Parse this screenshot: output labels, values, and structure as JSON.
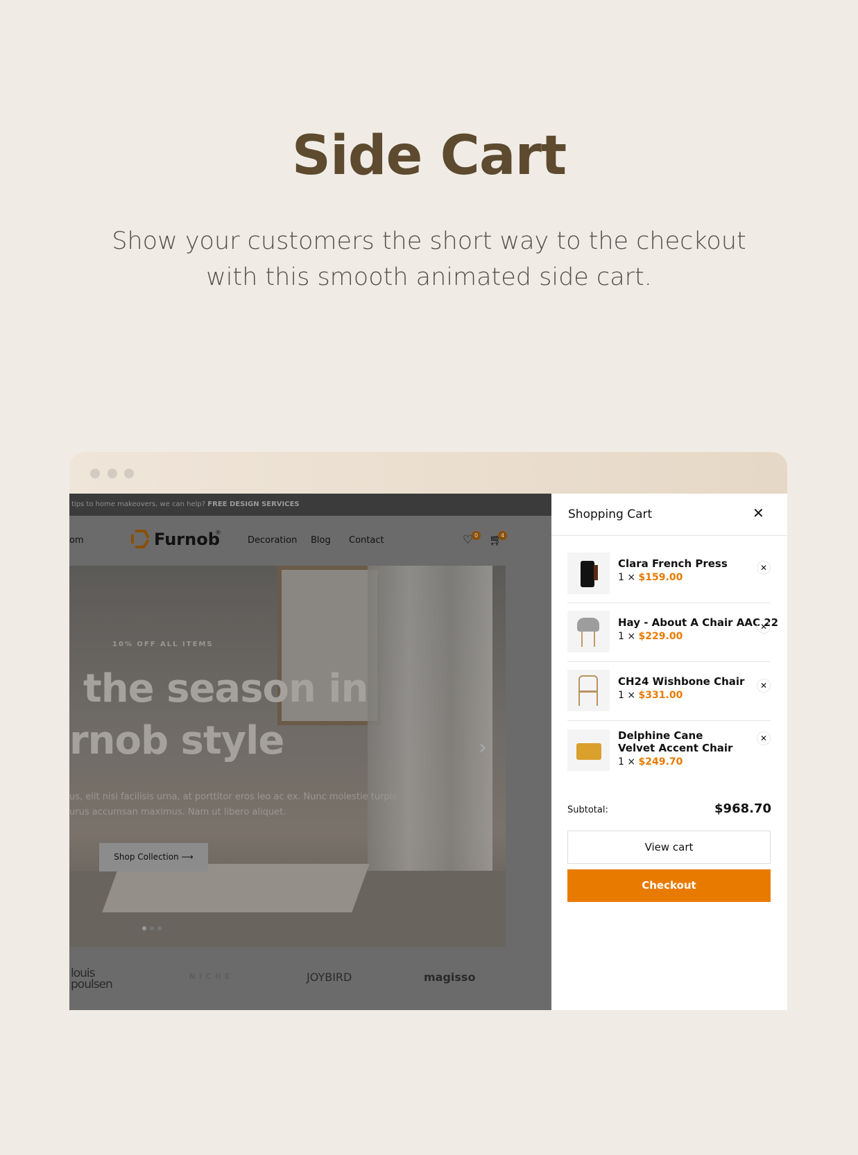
{
  "heading": {
    "title": "Side Cart",
    "subtitle_line1": "Show your customers the short way to the checkout",
    "subtitle_line2": "with this smooth animated side cart."
  },
  "site": {
    "topbar": {
      "text": "tips to home makeovers, we can help?",
      "link": "FREE DESIGN SERVICES"
    },
    "nav": {
      "partial_item": "om",
      "logo": "Furnob",
      "logo_mark": "®",
      "items": [
        "Decoration",
        "Blog",
        "Contact"
      ],
      "wishlist_count": "0",
      "cart_count": "4"
    },
    "hero": {
      "eyebrow": "10% OFF ALL ITEMS",
      "headline_line1": "the season in",
      "headline_line2": "rnob style",
      "body_line1": "us, elit nisi facilisis urna, at porttitor eros leo ac ex. Nunc molestie turpis",
      "body_line2": "urus accumsan maximus. Nam ut libero aliquet.",
      "cta": "Shop Collection",
      "cta_icon": "arrow-right-icon"
    },
    "brands": [
      "louis poulsen",
      "NICHE",
      "JOYBIRD",
      "magisso"
    ]
  },
  "cart": {
    "title": "Shopping Cart",
    "items": [
      {
        "name": "Clara French Press",
        "qty": "1 ×",
        "price": "$159.00"
      },
      {
        "name": "Hay - About A Chair AAC 22",
        "qty": "1 ×",
        "price": "$229.00"
      },
      {
        "name": "CH24 Wishbone Chair",
        "qty": "1 ×",
        "price": "$331.00"
      },
      {
        "name": "Delphine Cane Velvet Accent Chair",
        "qty": "1 ×",
        "price": "$249.70"
      }
    ],
    "subtotal_label": "Subtotal:",
    "subtotal": "$968.70",
    "view_cart": "View cart",
    "checkout": "Checkout"
  },
  "colors": {
    "accent": "#e97a00",
    "title": "#5d4a2f",
    "background": "#f0ece5"
  }
}
